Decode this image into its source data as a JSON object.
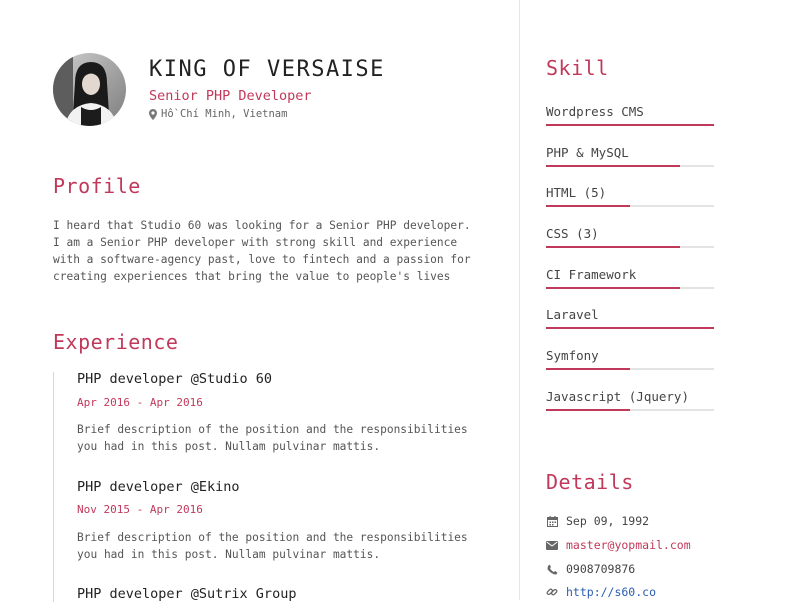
{
  "header": {
    "name": "KING OF VERSAISE",
    "role": "Senior PHP Developer",
    "location": "Hồ Chí Minh, Vietnam"
  },
  "profile": {
    "heading": "Profile",
    "lines": [
      "I heard that Studio 60 was looking for a Senior PHP developer.",
      "I am a Senior PHP developer with strong skill and experience",
      "with a software-agency past, love to fintech and a passion for",
      "creating experiences that bring the value to people's lives"
    ]
  },
  "experience": {
    "heading": "Experience",
    "jobs": [
      {
        "title": "PHP developer @Studio 60",
        "date": "Apr 2016 - Apr 2016",
        "desc_lines": [
          "Brief description of the position and the responsibilities",
          "you had in this post. Nullam pulvinar mattis."
        ]
      },
      {
        "title": "PHP developer @Ekino",
        "date": "Nov 2015 - Apr 2016",
        "desc_lines": [
          "Brief description of the position and the responsibilities",
          "you had in this post. Nullam pulvinar mattis."
        ]
      },
      {
        "title": "PHP developer @Sutrix Group",
        "date": "",
        "desc_lines": []
      }
    ]
  },
  "skills": {
    "heading": "Skill",
    "items": [
      {
        "label": "Wordpress CMS",
        "level": 1.0
      },
      {
        "label": "PHP & MySQL",
        "level": 0.8
      },
      {
        "label": "HTML (5)",
        "level": 0.5
      },
      {
        "label": "CSS (3)",
        "level": 0.8
      },
      {
        "label": "CI Framework",
        "level": 0.8
      },
      {
        "label": "Laravel",
        "level": 1.0
      },
      {
        "label": "Symfony",
        "level": 0.5
      },
      {
        "label": "Javascript (Jquery)",
        "level": 0.5
      }
    ]
  },
  "details": {
    "heading": "Details",
    "birthday": "Sep 09, 1992",
    "email": "master@yopmail.com",
    "phone": "0908709876",
    "website": "http://s60.co"
  },
  "icons": {
    "location": "map-marker-icon",
    "birthday": "calendar-icon",
    "email": "envelope-icon",
    "phone": "phone-icon",
    "website": "link-icon"
  },
  "colors": {
    "accent": "#c0395a",
    "link": "#2a5db0",
    "track": "#e3e3e3"
  }
}
